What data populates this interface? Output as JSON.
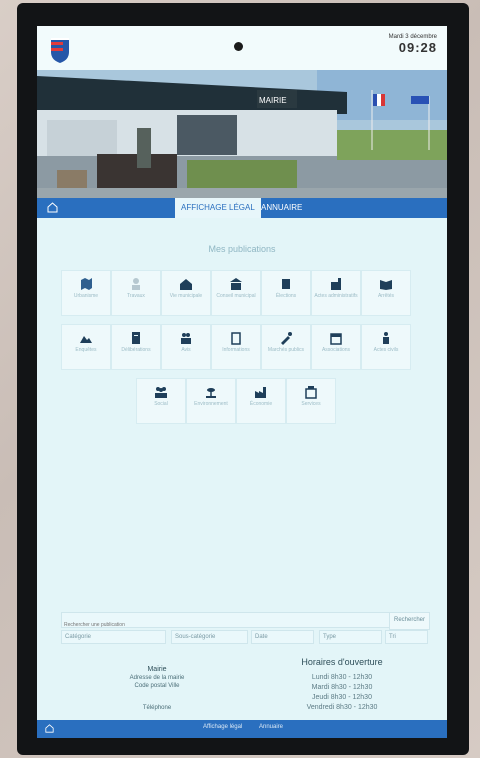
{
  "clock": {
    "date": "Mardi 3 décembre",
    "time": "09:28"
  },
  "photo": {
    "sign_text": "MAIRIE"
  },
  "nav": {
    "home_icon": "home-icon",
    "tabs": [
      "AFFICHAGE LÉGAL",
      "ANNUAIRE"
    ]
  },
  "section": {
    "title": "Mes publications"
  },
  "categories": [
    {
      "label": "Urbanisme"
    },
    {
      "label": "Travaux"
    },
    {
      "label": "Vie municipale"
    },
    {
      "label": "Conseil municipal"
    },
    {
      "label": "Élections"
    },
    {
      "label": "Actes administratifs"
    },
    {
      "label": "Arrêtés"
    },
    {
      "label": "Enquêtes"
    },
    {
      "label": "Délibérations"
    },
    {
      "label": "Avis"
    },
    {
      "label": "Informations"
    },
    {
      "label": "Marchés publics"
    },
    {
      "label": "Associations"
    },
    {
      "label": "Actes civils"
    },
    {
      "label": "Social"
    },
    {
      "label": "Environnement"
    },
    {
      "label": "Économie"
    },
    {
      "label": "Services"
    }
  ],
  "search": {
    "placeholder": "Rechercher une publication",
    "button": "Rechercher"
  },
  "filters": [
    "Catégorie",
    "Sous-catégorie",
    "Date",
    "Type",
    "Tri"
  ],
  "contact": {
    "name": "Mairie",
    "address": "Adresse de la mairie",
    "city": "Code postal Ville",
    "phone": "Téléphone"
  },
  "hours": {
    "title": "Horaires d'ouverture",
    "lines": [
      "Lundi 8h30 - 12h30",
      "Mardi 8h30 - 12h30",
      "Jeudi 8h30 - 12h30",
      "Vendredi 8h30 - 12h30"
    ]
  },
  "footer": {
    "left": "Affichage légal",
    "right": "Annuaire"
  }
}
